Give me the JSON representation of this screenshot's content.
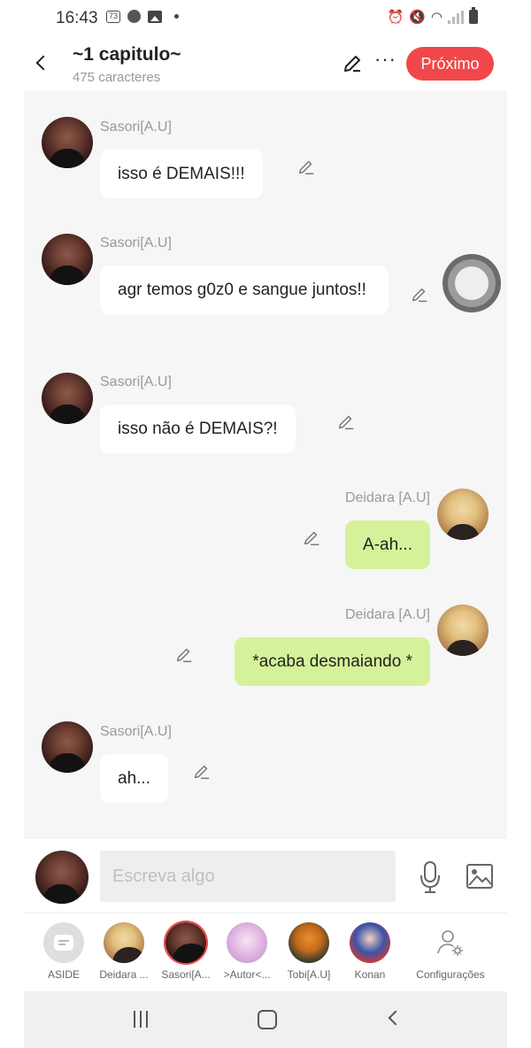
{
  "status_bar": {
    "time": "16:43",
    "badge": "73"
  },
  "header": {
    "title": "~1 capitulo~",
    "subtitle": "475 caracteres",
    "more": "···",
    "next_label": "Próximo"
  },
  "messages": [
    {
      "sender": "Sasori[A.U]",
      "text": "isso é  DEMAIS!!!",
      "side": "left"
    },
    {
      "sender": "Sasori[A.U]",
      "text": "agr temos g0z0 e sangue juntos!!",
      "side": "left"
    },
    {
      "sender": "Sasori[A.U]",
      "text": "isso não  é  DEMAIS?!",
      "side": "left"
    },
    {
      "sender": "Deidara [A.U]",
      "text": "A-ah...",
      "side": "right"
    },
    {
      "sender": "Deidara [A.U]",
      "text": "*acaba desmaiando *",
      "side": "right"
    },
    {
      "sender": "Sasori[A.U]",
      "text": "ah...",
      "side": "left"
    }
  ],
  "composer": {
    "placeholder": "Escreva algo"
  },
  "characters": [
    {
      "label": "ASIDE"
    },
    {
      "label": "Deidara ..."
    },
    {
      "label": "Sasori[A..."
    },
    {
      "label": ">Autor<..."
    },
    {
      "label": "Tobi[A.U]"
    },
    {
      "label": "Konan"
    },
    {
      "label": "Configurações"
    }
  ],
  "colors": {
    "accent": "#f2474a",
    "bubble_right": "#d5f29a",
    "bubble_left": "#ffffff",
    "chat_bg": "#f6f6f6"
  },
  "icons": {
    "back": "chevron-left-icon",
    "edit": "pencil-icon",
    "mic": "microphone-icon",
    "gallery": "image-icon",
    "settings": "user-gear-icon"
  }
}
